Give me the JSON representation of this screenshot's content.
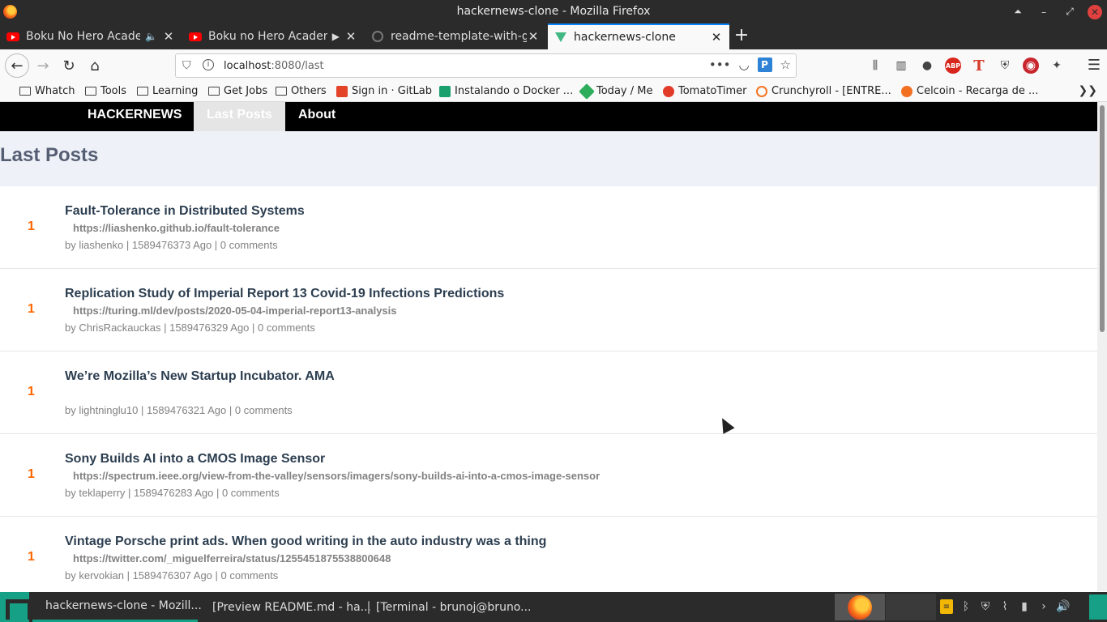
{
  "window": {
    "title": "hackernews-clone - Mozilla Firefox"
  },
  "tabs": [
    {
      "label": "Boku No Hero Academi",
      "icon": "youtube-icon",
      "extra": "🔈"
    },
    {
      "label": "Boku no Hero Academi",
      "icon": "youtube-icon",
      "extra": "▶"
    },
    {
      "label": "readme-template-with-gif",
      "icon": "github-icon",
      "extra": ""
    },
    {
      "label": "hackernews-clone",
      "icon": "vue-icon",
      "extra": ""
    }
  ],
  "urlbar": {
    "host": "localhost",
    "path": ":8080/last"
  },
  "bookmarks": [
    {
      "label": "Whatch",
      "type": "folder"
    },
    {
      "label": "Tools",
      "type": "folder"
    },
    {
      "label": "Learning",
      "type": "folder"
    },
    {
      "label": "Get Jobs",
      "type": "folder"
    },
    {
      "label": "Others",
      "type": "folder"
    },
    {
      "label": "Sign in · GitLab",
      "type": "gitlab-icon"
    },
    {
      "label": "Instalando o Docker ...",
      "type": "docker-icon"
    },
    {
      "label": "Today / Me",
      "type": "today-icon"
    },
    {
      "label": "TomatoTimer",
      "type": "tomato-icon"
    },
    {
      "label": "Crunchyroll - [ENTRE...",
      "type": "crunchyroll-icon"
    },
    {
      "label": "Celcoin - Recarga de ...",
      "type": "celcoin-icon"
    }
  ],
  "site": {
    "brand": "HACKERNEWS",
    "nav_last": "Last Posts",
    "nav_about": "About",
    "heading": "Last Posts"
  },
  "posts": [
    {
      "score": "1",
      "title": "Fault-Tolerance in Distributed Systems",
      "host": "https://liashenko.github.io/fault-tolerance",
      "meta": "by liashenko | 1589476373 Ago | 0 comments"
    },
    {
      "score": "1",
      "title": "Replication Study of Imperial Report 13 Covid-19 Infections Predictions",
      "host": "https://turing.ml/dev/posts/2020-05-04-imperial-report13-analysis",
      "meta": "by ChrisRackauckas | 1589476329 Ago | 0 comments"
    },
    {
      "score": "1",
      "title": "We’re Mozilla’s New Startup Incubator. AMA",
      "host": "",
      "meta": "by lightninglu10 | 1589476321 Ago | 0 comments"
    },
    {
      "score": "1",
      "title": "Sony Builds AI into a CMOS Image Sensor",
      "host": "https://spectrum.ieee.org/view-from-the-valley/sensors/imagers/sony-builds-ai-into-a-cmos-image-sensor",
      "meta": "by teklaperry | 1589476283 Ago | 0 comments"
    },
    {
      "score": "1",
      "title": "Vintage Porsche print ads. When good writing in the auto industry was a thing",
      "host": "https://twitter.com/_miguelferreira/status/1255451875538800648",
      "meta": "by kervokian | 1589476307 Ago | 0 comments"
    }
  ],
  "taskbar": {
    "tasks": [
      "hackernews-clone - Mozill...",
      "[Preview README.md - ha...",
      "[Terminal - brunoj@bruno..."
    ]
  },
  "colors": {
    "accent": "#16a085",
    "score": "#ff6600",
    "header": "#000000",
    "hero": "#eef1f8"
  }
}
